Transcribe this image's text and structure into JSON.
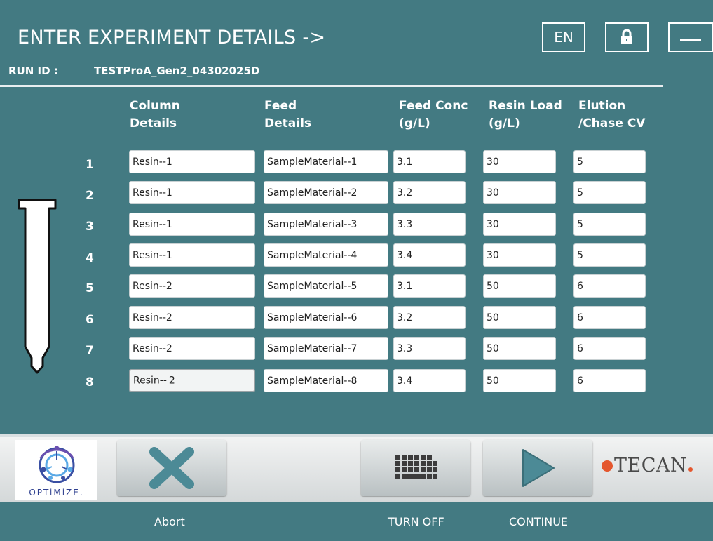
{
  "header": {
    "title": "ENTER EXPERIMENT DETAILS ->",
    "language_label": "EN",
    "run_id_label": "RUN ID :",
    "run_id_value": "TESTProA_Gen2_04302025D"
  },
  "table": {
    "columns": [
      {
        "line1": "Column",
        "line2": "Details"
      },
      {
        "line1": "Feed",
        "line2": "Details"
      },
      {
        "line1": "Feed Conc",
        "line2": "(g/L)"
      },
      {
        "line1": "Resin Load",
        "line2": "(g/L)"
      },
      {
        "line1": "Elution",
        "line2": "/Chase CV"
      }
    ],
    "rows": [
      {
        "num": "1",
        "column": "Resin--1",
        "feed": "SampleMaterial--1",
        "conc": "3.1",
        "load": "30",
        "elution": "5"
      },
      {
        "num": "2",
        "column": "Resin--1",
        "feed": "SampleMaterial--2",
        "conc": "3.2",
        "load": "30",
        "elution": "5"
      },
      {
        "num": "3",
        "column": "Resin--1",
        "feed": "SampleMaterial--3",
        "conc": "3.3",
        "load": "30",
        "elution": "5"
      },
      {
        "num": "4",
        "column": "Resin--1",
        "feed": "SampleMaterial--4",
        "conc": "3.4",
        "load": "30",
        "elution": "5"
      },
      {
        "num": "5",
        "column": "Resin--2",
        "feed": "SampleMaterial--5",
        "conc": "3.1",
        "load": "50",
        "elution": "6"
      },
      {
        "num": "6",
        "column": "Resin--2",
        "feed": "SampleMaterial--6",
        "conc": "3.2",
        "load": "50",
        "elution": "6"
      },
      {
        "num": "7",
        "column": "Resin--2",
        "feed": "SampleMaterial--7",
        "conc": "3.3",
        "load": "50",
        "elution": "6"
      },
      {
        "num": "8",
        "column": "Resin--2",
        "feed": "SampleMaterial--8",
        "conc": "3.4",
        "load": "50",
        "elution": "6"
      }
    ]
  },
  "footer": {
    "logo_text": "OPTiMiZE.",
    "abort_label": "Abort",
    "turn_off_label": "TURN OFF",
    "continue_label": "CONTINUE",
    "brand": "TECAN"
  },
  "icons": {
    "lock": "lock-icon",
    "minimize": "minimize-icon",
    "abort": "x-icon",
    "turn_off": "keyboard-icon",
    "continue": "play-icon",
    "column": "column-icon"
  },
  "colors": {
    "background": "#437a82",
    "accent_icon": "#4c8a96",
    "brand_dot": "#e4572e"
  }
}
